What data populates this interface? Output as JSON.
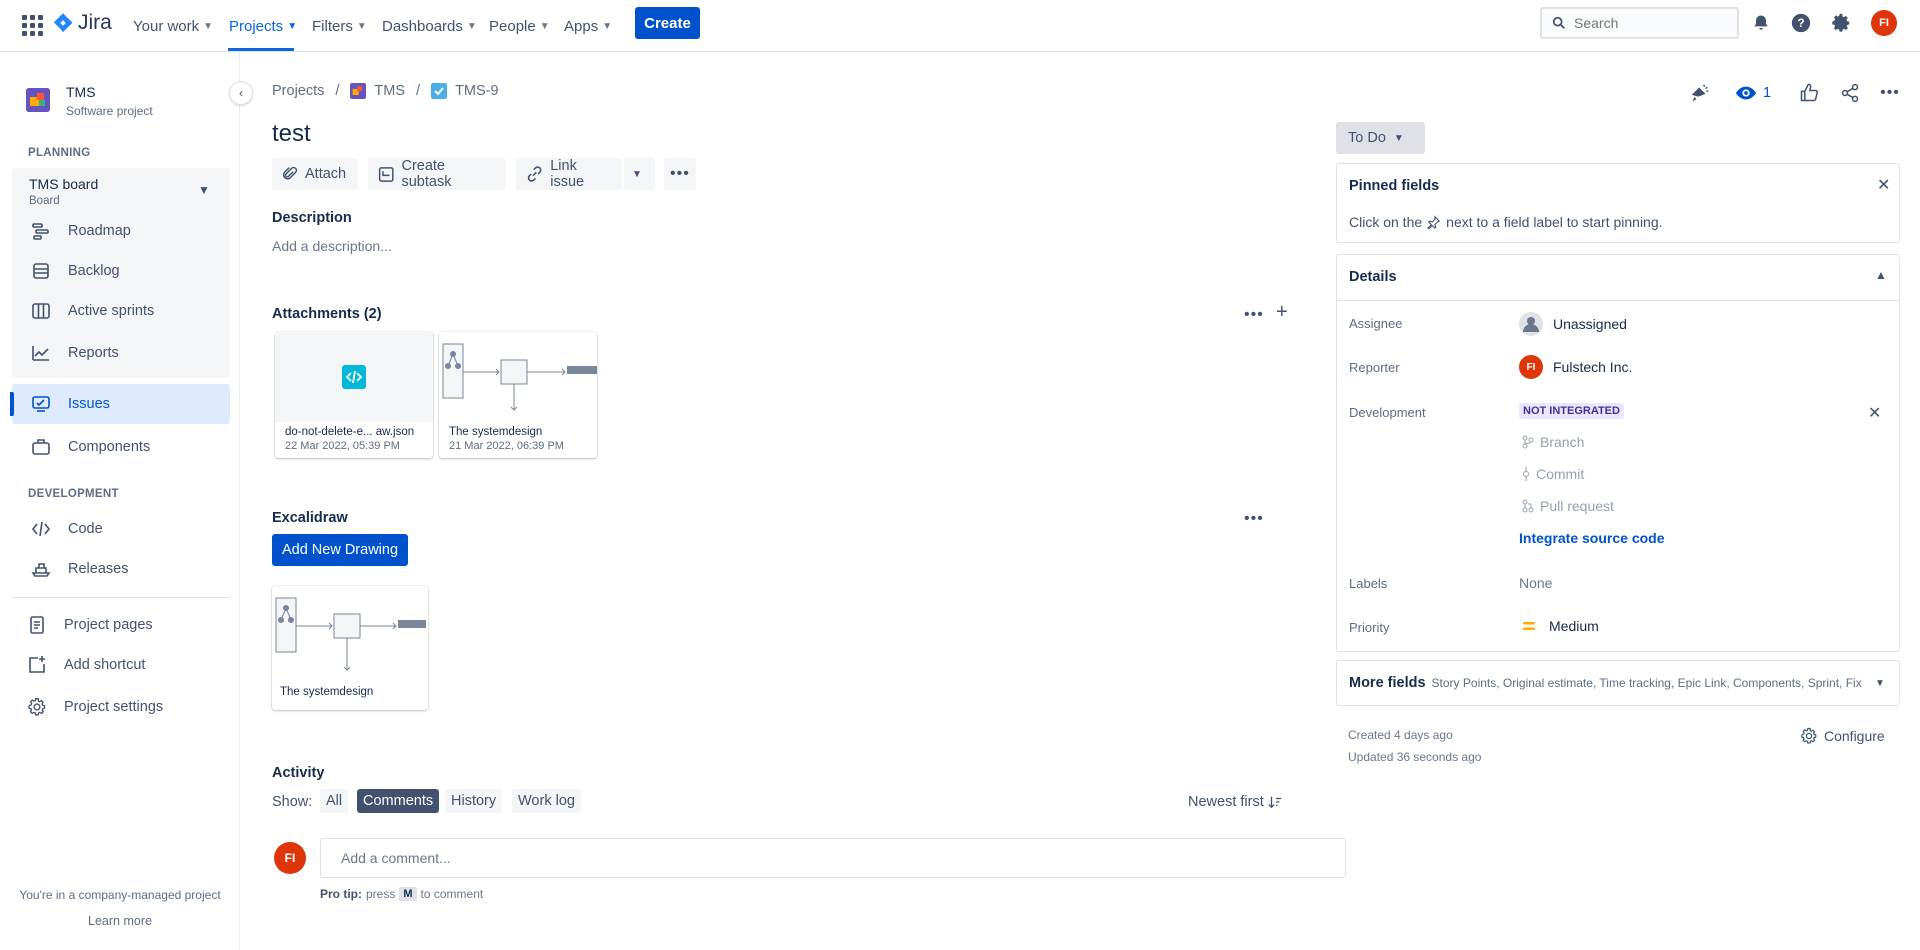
{
  "topnav": {
    "logo": "Jira",
    "items": [
      {
        "label": "Your work"
      },
      {
        "label": "Projects"
      },
      {
        "label": "Filters"
      },
      {
        "label": "Dashboards"
      },
      {
        "label": "People"
      },
      {
        "label": "Apps"
      }
    ],
    "create_label": "Create",
    "search_placeholder": "Search",
    "avatar_initials": "FI"
  },
  "sidebar": {
    "project_name": "TMS",
    "project_type": "Software project",
    "planning_heading": "PLANNING",
    "board_name": "TMS board",
    "board_sub": "Board",
    "planning_items": [
      {
        "label": "Roadmap",
        "icon": "roadmap-icon"
      },
      {
        "label": "Backlog",
        "icon": "backlog-icon"
      },
      {
        "label": "Active sprints",
        "icon": "sprints-icon"
      },
      {
        "label": "Reports",
        "icon": "reports-icon"
      }
    ],
    "issues_label": "Issues",
    "components_label": "Components",
    "development_heading": "DEVELOPMENT",
    "dev_items": [
      {
        "label": "Code"
      },
      {
        "label": "Releases"
      }
    ],
    "bottom_items": [
      {
        "label": "Project pages"
      },
      {
        "label": "Add shortcut"
      },
      {
        "label": "Project settings"
      }
    ],
    "footer_text": "You're in a company-managed project",
    "learn_more": "Learn more"
  },
  "breadcrumb": {
    "projects": "Projects",
    "project": "TMS",
    "issue_key": "TMS-9"
  },
  "issue": {
    "title": "test",
    "toolbar": {
      "attach": "Attach",
      "create_subtask": "Create subtask",
      "link_issue": "Link issue"
    },
    "description_label": "Description",
    "description_placeholder": "Add a description...",
    "attachments_label": "Attachments (2)",
    "attachments": [
      {
        "name": "do-not-delete-e... aw.json",
        "date": "22 Mar 2022, 05:39 PM"
      },
      {
        "name": "The systemdesign",
        "date": "21 Mar 2022, 06:39 PM"
      }
    ],
    "excalidraw_label": "Excalidraw",
    "add_drawing_label": "Add New Drawing",
    "drawing_name": "The systemdesign",
    "activity_label": "Activity",
    "show_label": "Show:",
    "filters": [
      "All",
      "Comments",
      "History",
      "Work log"
    ],
    "selected_filter": "Comments",
    "sort_label": "Newest first",
    "comment_placeholder": "Add a comment...",
    "protip_label": "Pro tip:",
    "protip_press": "press",
    "protip_key": "M",
    "protip_suffix": "to comment"
  },
  "right": {
    "watch_count": "1",
    "status": "To Do",
    "pinned_title": "Pinned fields",
    "pinned_text_1": "Click on the",
    "pinned_text_2": "next to a field label to start pinning.",
    "details_title": "Details",
    "fields": {
      "assignee_label": "Assignee",
      "assignee_value": "Unassigned",
      "reporter_label": "Reporter",
      "reporter_value": "Fulstech Inc.",
      "reporter_initials": "FI",
      "development_label": "Development",
      "development_badge": "NOT INTEGRATED",
      "dev_branch": "Branch",
      "dev_commit": "Commit",
      "dev_pr": "Pull request",
      "integrate_link": "Integrate source code",
      "labels_label": "Labels",
      "labels_value": "None",
      "priority_label": "Priority",
      "priority_value": "Medium"
    },
    "more_fields_title": "More fields",
    "more_fields_list": "Story Points, Original estimate, Time tracking, Epic Link, Components, Sprint, Fix...",
    "created": "Created 4 days ago",
    "updated": "Updated 36 seconds ago",
    "configure": "Configure"
  },
  "colors": {
    "brand": "#0052cc",
    "avatar": "#de350b",
    "priority": "#ffab00"
  }
}
